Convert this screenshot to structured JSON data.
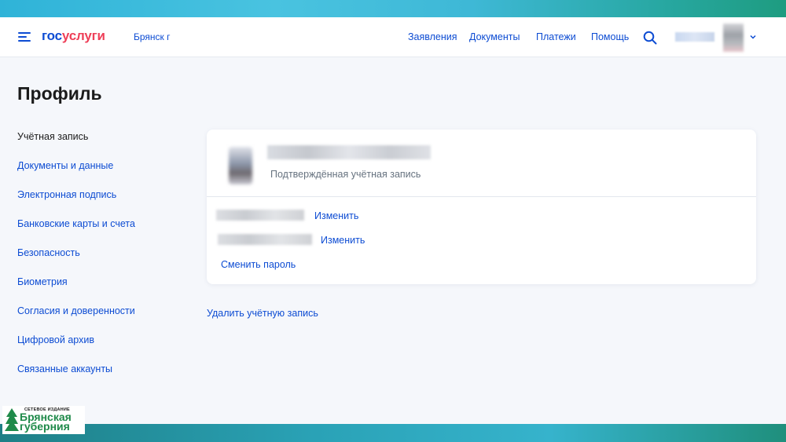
{
  "header": {
    "logo_part1": "гос",
    "logo_part2": "услуги",
    "city": "Брянск г",
    "nav": [
      "Заявления",
      "Документы",
      "Платежи",
      "Помощь"
    ]
  },
  "page_title": "Профиль",
  "sidebar": {
    "items": [
      {
        "label": "Учётная запись",
        "active": true
      },
      {
        "label": "Документы и данные",
        "active": false
      },
      {
        "label": "Электронная подпись",
        "active": false
      },
      {
        "label": "Банковские карты и счета",
        "active": false
      },
      {
        "label": "Безопасность",
        "active": false
      },
      {
        "label": "Биометрия",
        "active": false
      },
      {
        "label": "Согласия и доверенности",
        "active": false
      },
      {
        "label": "Цифровой архив",
        "active": false
      },
      {
        "label": "Связанные аккаунты",
        "active": false
      }
    ]
  },
  "account_card": {
    "status": "Подтверждённая учётная запись",
    "change_label_1": "Изменить",
    "change_label_2": "Изменить",
    "change_password": "Сменить пароль"
  },
  "delete_account": "Удалить учётную запись",
  "watermark": {
    "small": "СЕТЕВОЕ ИЗДАНИЕ",
    "line1": "Брянская",
    "line2": "губерния"
  },
  "colors": {
    "link": "#0d4cd3",
    "brand_red": "#ee3f58",
    "background": "#f5f7fb",
    "watermark_green": "#1f8a4a"
  },
  "icons": [
    "menu-icon",
    "search-icon",
    "chevron-down-icon",
    "tree-icon"
  ]
}
